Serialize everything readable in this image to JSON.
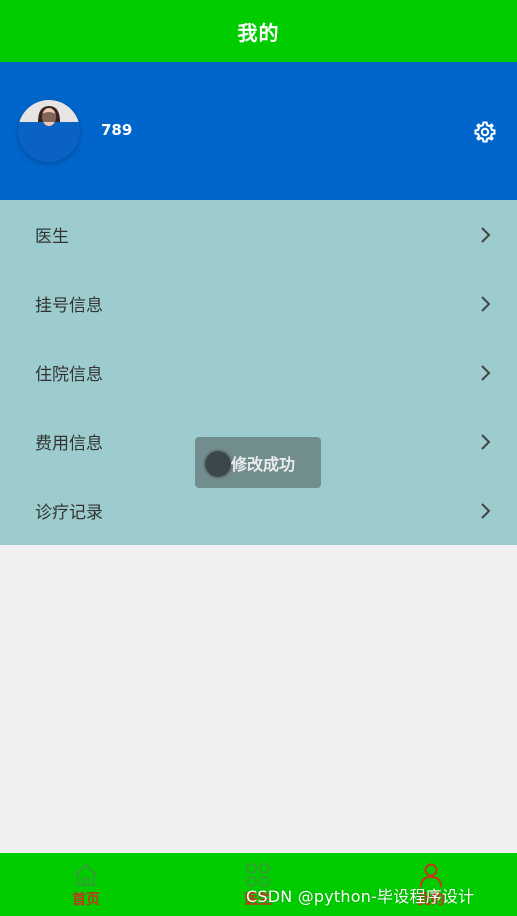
{
  "header": {
    "title": "我的"
  },
  "profile": {
    "username": "789"
  },
  "menu": {
    "items": [
      {
        "label": "医生"
      },
      {
        "label": "挂号信息"
      },
      {
        "label": "住院信息"
      },
      {
        "label": "费用信息"
      },
      {
        "label": "诊疗记录"
      }
    ]
  },
  "toast": {
    "text": "修改成功"
  },
  "tabbar": {
    "items": [
      {
        "label": "首页",
        "icon": "home-icon"
      },
      {
        "label": "医生",
        "icon": "clover-icon"
      },
      {
        "label": "我的",
        "icon": "user-icon"
      }
    ]
  },
  "watermark": {
    "text": "CSDN @python-毕设程序设计"
  },
  "colors": {
    "header": "#00cc00",
    "profile": "#0066cc",
    "menu": "#9cccce",
    "tab_label": "#c0391b"
  }
}
